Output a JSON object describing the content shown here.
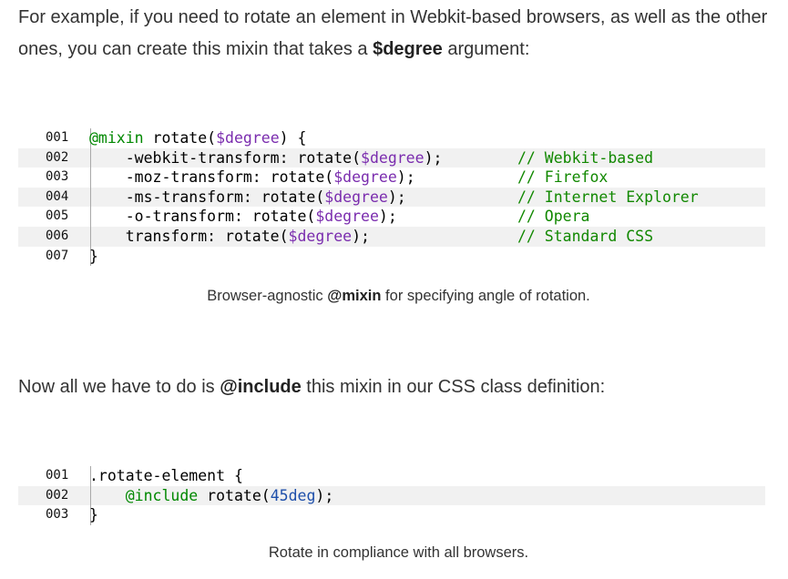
{
  "intro": {
    "text_before": "For example, if you need to rotate an element in Webkit-based browsers, as well as the other ones, you can create this mixin that takes a ",
    "code_word": "$degree",
    "text_after": " argument:"
  },
  "code_block_1": {
    "lines": [
      {
        "num": "001",
        "parts": [
          [
            "k",
            "@mixin"
          ],
          [
            "",
            " rotate("
          ],
          [
            "v",
            "$degree"
          ],
          [
            "",
            ") {"
          ]
        ],
        "comment": ""
      },
      {
        "num": "002",
        "parts": [
          [
            "",
            "    -webkit-transform: rotate("
          ],
          [
            "v",
            "$degree"
          ],
          [
            "",
            ");"
          ]
        ],
        "comment": "// Webkit-based"
      },
      {
        "num": "003",
        "parts": [
          [
            "",
            "    -moz-transform: rotate("
          ],
          [
            "v",
            "$degree"
          ],
          [
            "",
            ");"
          ]
        ],
        "comment": "// Firefox"
      },
      {
        "num": "004",
        "parts": [
          [
            "",
            "    -ms-transform: rotate("
          ],
          [
            "v",
            "$degree"
          ],
          [
            "",
            ");"
          ]
        ],
        "comment": "// Internet Explorer"
      },
      {
        "num": "005",
        "parts": [
          [
            "",
            "    -o-transform: rotate("
          ],
          [
            "v",
            "$degree"
          ],
          [
            "",
            ");"
          ]
        ],
        "comment": "// Opera"
      },
      {
        "num": "006",
        "parts": [
          [
            "",
            "    transform: rotate("
          ],
          [
            "v",
            "$degree"
          ],
          [
            "",
            ");"
          ]
        ],
        "comment": "// Standard CSS"
      },
      {
        "num": "007",
        "parts": [
          [
            "",
            "}"
          ]
        ],
        "comment": ""
      }
    ]
  },
  "caption_1": {
    "text_before": "Browser-agnostic ",
    "code_word": "@mixin",
    "text_after": " for specifying angle of rotation."
  },
  "paragraph_2": {
    "text_before": "Now all we have to do is ",
    "code_word": "@include",
    "text_after": " this mixin in our CSS class definition:"
  },
  "code_block_2": {
    "lines": [
      {
        "num": "001",
        "parts": [
          [
            "",
            ".rotate-element {"
          ]
        ],
        "comment": ""
      },
      {
        "num": "002",
        "parts": [
          [
            "",
            "    "
          ],
          [
            "k",
            "@include"
          ],
          [
            "",
            " rotate("
          ],
          [
            "n",
            "45deg"
          ],
          [
            "",
            ");"
          ]
        ],
        "comment": ""
      },
      {
        "num": "003",
        "parts": [
          [
            "",
            "}"
          ]
        ],
        "comment": ""
      }
    ]
  },
  "caption_2": {
    "text": "Rotate in compliance with all browsers."
  }
}
